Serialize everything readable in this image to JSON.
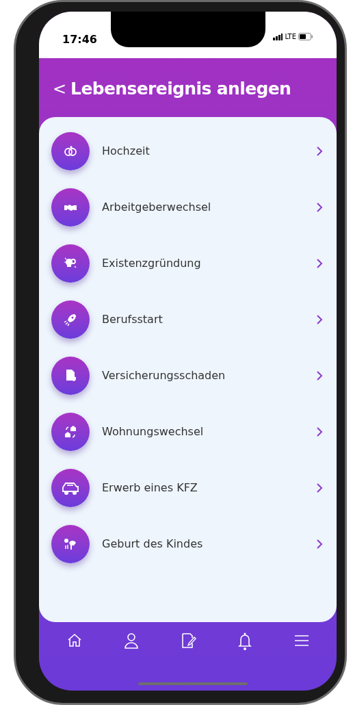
{
  "status_bar": {
    "time": "17:46",
    "network": "LTE"
  },
  "header": {
    "back": "<",
    "title": "Lebensereignis anlegen"
  },
  "events": [
    {
      "label": "Hochzeit"
    },
    {
      "label": "Arbeitgeberwechsel"
    },
    {
      "label": "Existenzgründung"
    },
    {
      "label": "Berufsstart"
    },
    {
      "label": "Versicherungsschaden"
    },
    {
      "label": "Wohnungswechsel"
    },
    {
      "label": "Erwerb eines KFZ"
    },
    {
      "label": "Geburt des Kindes"
    }
  ]
}
